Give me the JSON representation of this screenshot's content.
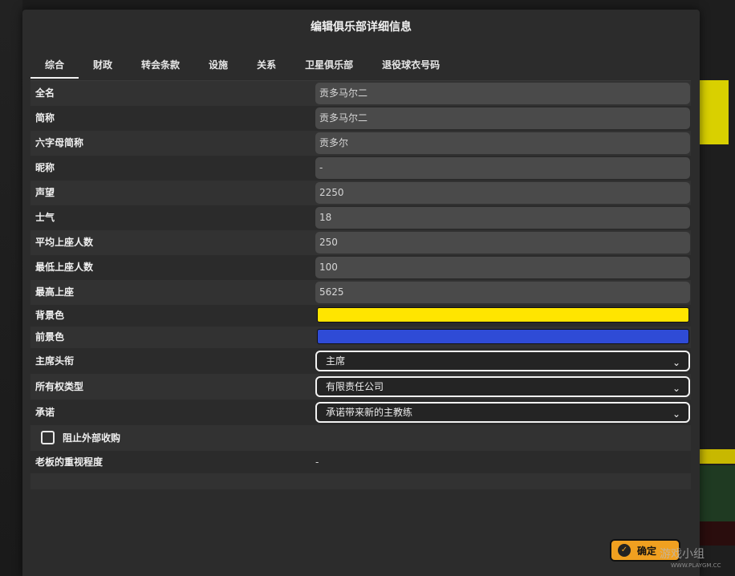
{
  "dialog": {
    "title": "编辑俱乐部详细信息",
    "confirm_label": "确定"
  },
  "tabs": [
    {
      "label": "综合",
      "active": true
    },
    {
      "label": "财政"
    },
    {
      "label": "转会条款"
    },
    {
      "label": "设施"
    },
    {
      "label": "关系"
    },
    {
      "label": "卫星俱乐部"
    },
    {
      "label": "退役球衣号码"
    }
  ],
  "fields": {
    "full_name": {
      "label": "全名",
      "value": "贡多马尔二"
    },
    "short_name": {
      "label": "简称",
      "value": "贡多马尔二"
    },
    "six_letter": {
      "label": "六字母简称",
      "value": "贡多尔"
    },
    "nickname": {
      "label": "昵称",
      "value": "-"
    },
    "reputation": {
      "label": "声望",
      "value": "2250"
    },
    "morale": {
      "label": "士气",
      "value": "18"
    },
    "avg_attendance": {
      "label": "平均上座人数",
      "value": "250"
    },
    "min_attendance": {
      "label": "最低上座人数",
      "value": "100"
    },
    "max_attendance": {
      "label": "最高上座",
      "value": "5625"
    }
  },
  "colors": {
    "background": {
      "label": "背景色",
      "value": "#ffe500"
    },
    "foreground": {
      "label": "前景色",
      "value": "#2f4bd6"
    }
  },
  "selects": {
    "chairman_title": {
      "label": "主席头衔",
      "value": "主席"
    },
    "ownership": {
      "label": "所有权类型",
      "value": "有限责任公司"
    },
    "promise": {
      "label": "承诺",
      "value": "承诺带来新的主教练"
    }
  },
  "block_takeover": {
    "label": "阻止外部收购",
    "checked": false
  },
  "owner_priority": {
    "label": "老板的重视程度",
    "value": "-"
  },
  "watermark": {
    "text": "游戏小组",
    "url": "WWW.PLAYGM.CC"
  },
  "icons": {
    "chevron": "chevron-down-icon",
    "confirm": "confirm-icon"
  }
}
